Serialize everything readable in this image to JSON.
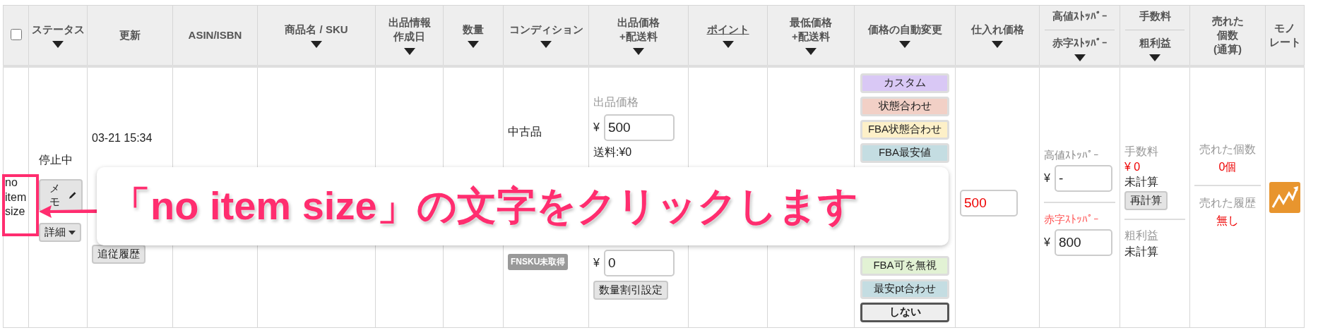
{
  "header": {
    "select_all_checked": false,
    "columns": [
      {
        "label": "ステータス",
        "sortable": true
      },
      {
        "label": "更新",
        "sortable": false
      },
      {
        "label": "ASIN/ISBN",
        "sortable": false
      },
      {
        "label": "商品名 / SKU",
        "sortable": true
      },
      {
        "label": [
          "出品情報",
          "作成日"
        ],
        "sortable": true
      },
      {
        "label": "数量",
        "sortable": true
      },
      {
        "label": "コンディション",
        "sortable": true
      },
      {
        "label": [
          "出品価格",
          "+配送料"
        ],
        "sortable": true
      },
      {
        "label": "ポイント",
        "sortable": true,
        "link": true
      },
      {
        "label": [
          "最低価格",
          "+配送料"
        ],
        "sortable": true
      },
      {
        "label": "価格の自動変更",
        "sortable": true
      },
      {
        "label": "仕入れ価格",
        "sortable": true
      },
      {
        "label": "高値ｽﾄｯﾊﾟｰ",
        "sublabel": "赤字ｽﾄｯﾊﾟｰ",
        "sortable": true
      },
      {
        "label": "手数料",
        "sublabel": "粗利益",
        "sortable": true
      },
      {
        "label": [
          "売れた",
          "個数",
          "(通算)"
        ],
        "sortable": false
      },
      {
        "label": [
          "モノ",
          "レート"
        ],
        "sortable": false
      }
    ]
  },
  "row": {
    "size_note": "no item size",
    "status": "停止中",
    "memo_button": "メモ",
    "detail_button": "詳細",
    "updated": "03-21 15:34",
    "history_button": "追従履歴",
    "condition": "中古品",
    "fnsku_badge": "FNSKU未取得",
    "price_label": "出品価格",
    "currency": "¥",
    "price": "500",
    "shipping": "送料:¥0",
    "lower_price": "0",
    "bulk_discount_button": "数量割引設定",
    "auto_change_top": [
      {
        "label": "カスタム",
        "color": "#d9c8f5",
        "selected": false
      },
      {
        "label": "状態合わせ",
        "color": "#f2d0c6",
        "selected": false
      },
      {
        "label": "FBA状態合わせ",
        "color": "#fdf0c8",
        "selected": false
      },
      {
        "label": "FBA最安値",
        "color": "#c4dde2",
        "selected": false
      }
    ],
    "auto_change_bottom": [
      {
        "label": "FBA可を無視",
        "color": "#e2f2d4",
        "selected": false
      },
      {
        "label": "最安pt合わせ",
        "color": "#c4dde2",
        "selected": false
      },
      {
        "label": "しない",
        "color": "#eeeeee",
        "selected": true
      }
    ],
    "purchase_price": "500",
    "high_stopper_label": "高値ｽﾄｯﾊﾟｰ",
    "high_stopper": "-",
    "loss_stopper_label": "赤字ｽﾄｯﾊﾟｰ",
    "loss_stopper": "800",
    "fee_label": "手数料",
    "fee": "¥ 0",
    "fee_status": "未計算",
    "recalc_button": "再計算",
    "profit_label": "粗利益",
    "profit_status": "未計算",
    "sold_count_label": "売れた個数",
    "sold_count": "0個",
    "sold_history_label": "売れた履歴",
    "sold_history": "無し"
  },
  "annotation": {
    "text": "「no item size」の文字をクリックします"
  }
}
